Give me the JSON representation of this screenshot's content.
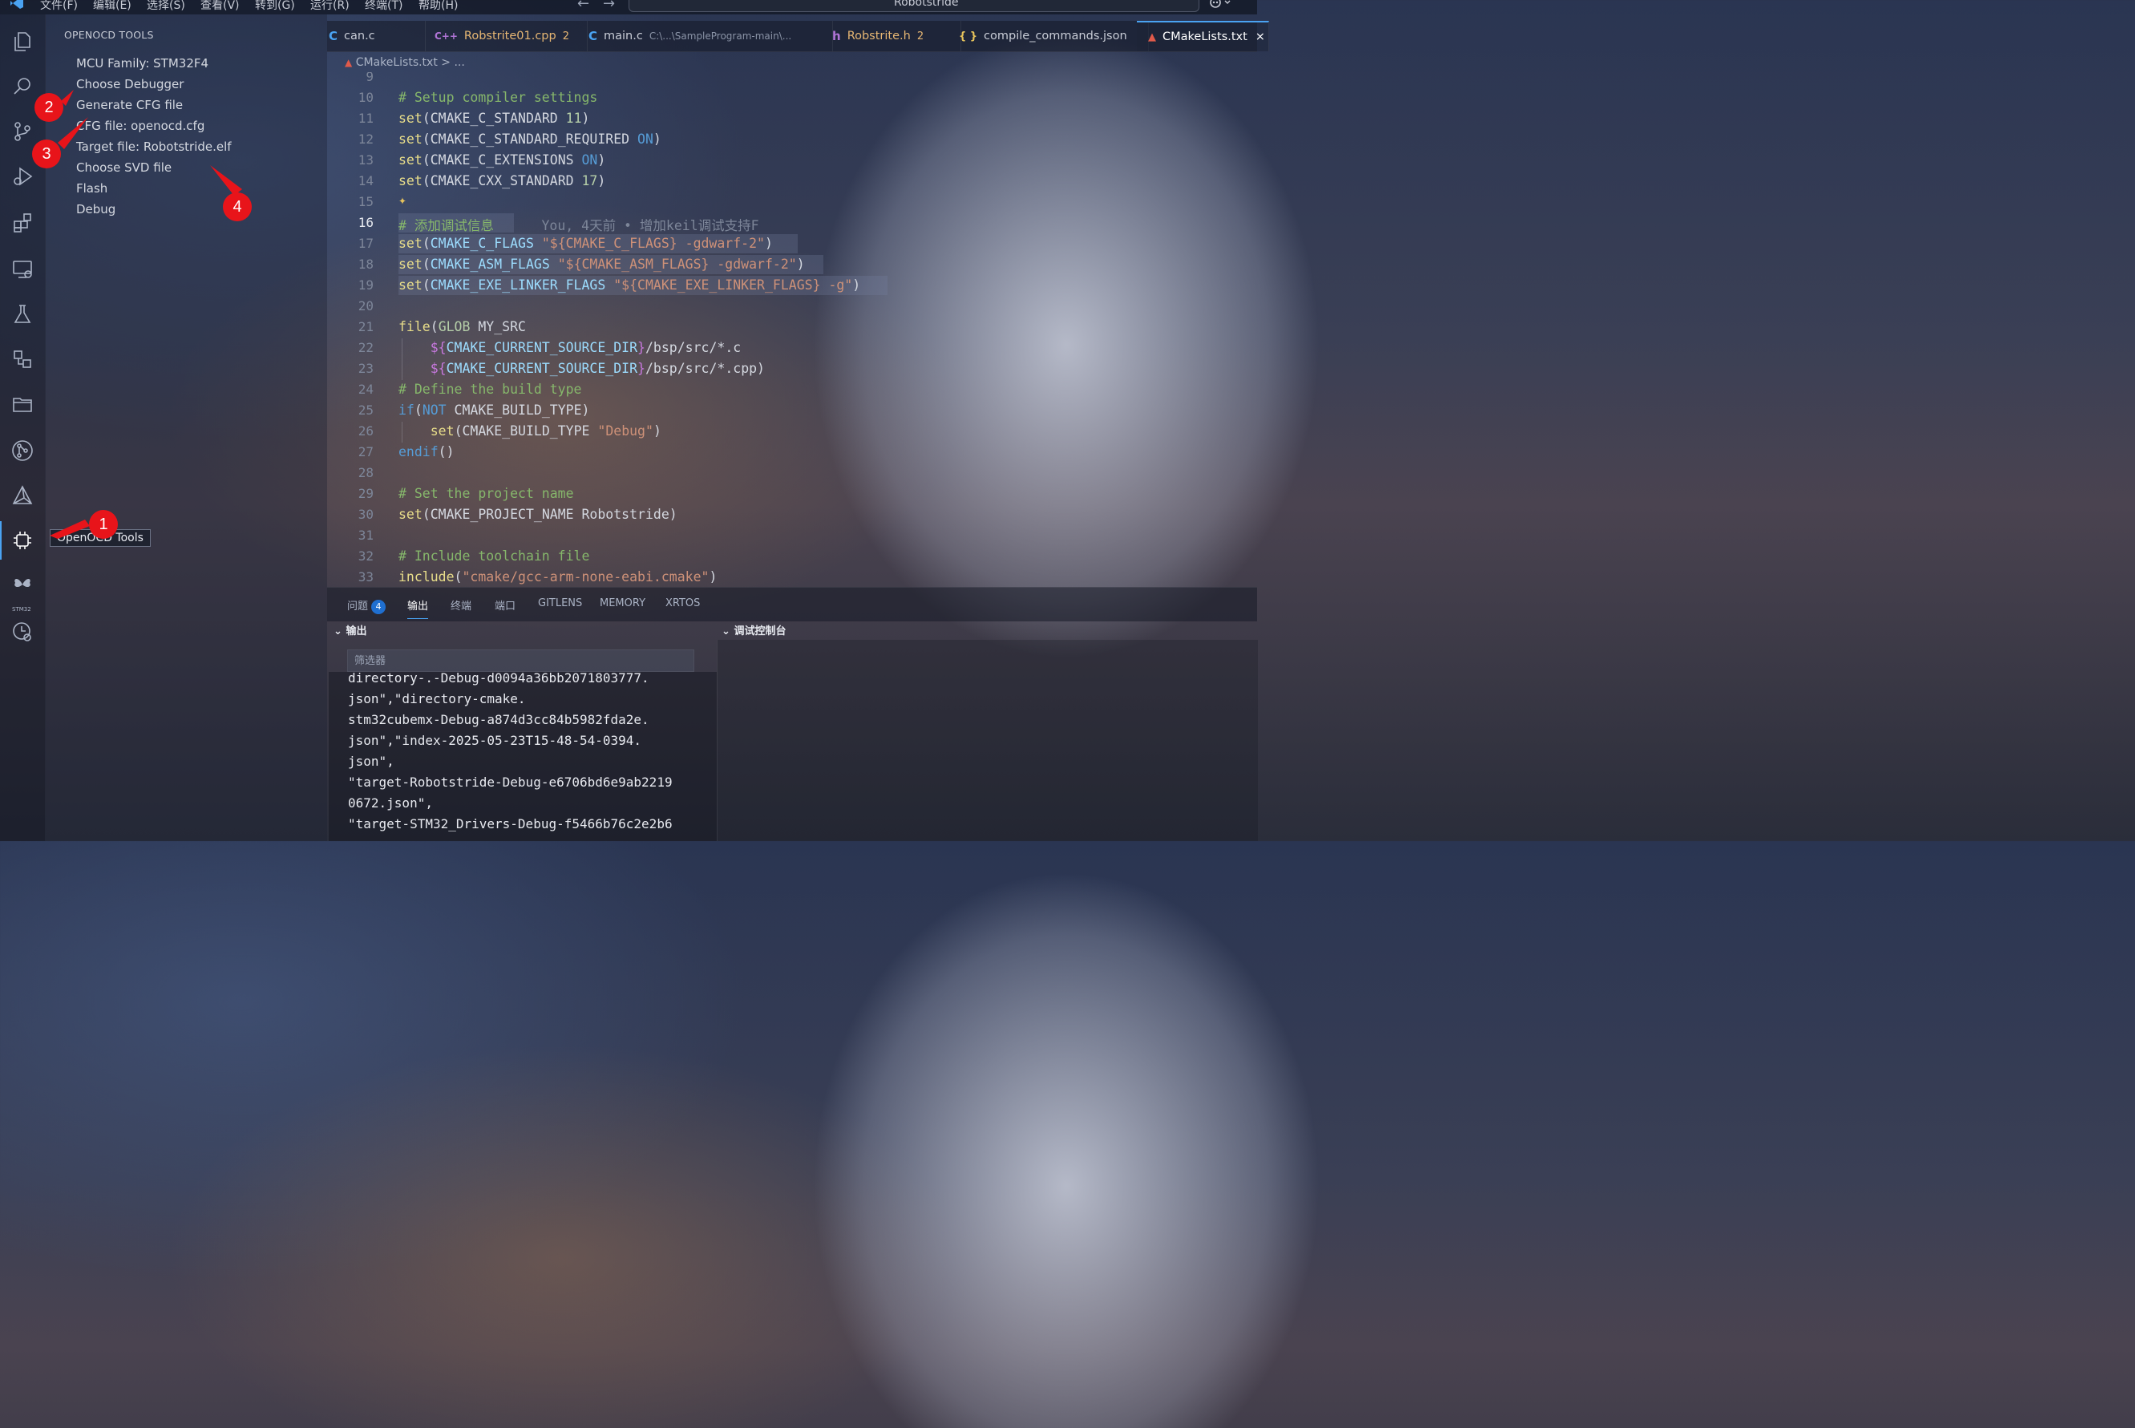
{
  "menubar": {
    "items": [
      "文件(F)",
      "编辑(E)",
      "选择(S)",
      "查看(V)",
      "转到(G)",
      "运行(R)",
      "终端(T)",
      "帮助(H)"
    ],
    "back_glyph": "←",
    "forward_glyph": "→",
    "search_text": "Robotstride"
  },
  "activity": {
    "stm_label": "STM32",
    "tooltip": "OpenOCD Tools"
  },
  "sidebar": {
    "title": "OPENOCD TOOLS",
    "items": [
      "MCU Family: STM32F4",
      "Choose Debugger",
      "Generate CFG file",
      "CFG file: openocd.cfg",
      "Target file: Robotstride.elf",
      "Choose SVD file",
      "Flash",
      "Debug"
    ]
  },
  "annotations": [
    "1",
    "2",
    "3",
    "4"
  ],
  "tabs": [
    {
      "label": "can.c",
      "icon": "C",
      "icon_color": "#4aa3f2"
    },
    {
      "label": "Robstrite01.cpp",
      "icon": "C++",
      "icon_color": "#b074d6",
      "count": "2"
    },
    {
      "label": "main.c",
      "icon": "C",
      "icon_color": "#4aa3f2",
      "path": "C:\\...\\SampleProgram-main\\..."
    },
    {
      "label": "Robstrite.h",
      "icon": "h",
      "icon_color": "#b074d6",
      "count": "2"
    },
    {
      "label": "compile_commands.json",
      "icon": "{ }",
      "icon_color": "#e6c35c"
    },
    {
      "label": "CMakeLists.txt",
      "icon": "▲",
      "icon_color": "#e05a4a",
      "close": "×"
    }
  ],
  "breadcrumb": {
    "file": "CMakeLists.txt",
    "sep": ">",
    "more": "..."
  },
  "editor": {
    "line_numbers": [
      "9",
      "10",
      "11",
      "12",
      "13",
      "14",
      "15",
      "16",
      "17",
      "18",
      "19",
      "20",
      "21",
      "22",
      "23",
      "24",
      "25",
      "26",
      "27",
      "28",
      "29",
      "30",
      "31",
      "32",
      "33"
    ],
    "l10": "# Setup compiler settings",
    "l11": {
      "fn": "set",
      "p1": "(",
      "var": "CMAKE_C_STANDARD",
      "num": " 11",
      "p2": ")"
    },
    "l12": {
      "fn": "set",
      "p1": "(",
      "var": "CMAKE_C_STANDARD_REQUIRED",
      "kw": " ON",
      "p2": ")"
    },
    "l13": {
      "fn": "set",
      "p1": "(",
      "var": "CMAKE_C_EXTENSIONS",
      "kw": " ON",
      "p2": ")"
    },
    "l14": {
      "fn": "set",
      "p1": "(",
      "var": "CMAKE_CXX_STANDARD",
      "num": " 17",
      "p2": ")"
    },
    "l15_icon": "✦",
    "l16": {
      "comment": "# 添加调试信息",
      "blame": "You, 4天前 • 增加keil调试支持F"
    },
    "l17": {
      "fn": "set",
      "p1": "(",
      "var": "CMAKE_C_FLAGS",
      "str": " \"${CMAKE_C_FLAGS} -gdwarf-2\"",
      "p2": ")"
    },
    "l18": {
      "fn": "set",
      "p1": "(",
      "var": "CMAKE_ASM_FLAGS",
      "str": " \"${CMAKE_ASM_FLAGS} -gdwarf-2\"",
      "p2": ")"
    },
    "l19": {
      "fn": "set",
      "p1": "(",
      "var": "CMAKE_EXE_LINKER_FLAGS",
      "str": " \"${CMAKE_EXE_LINKER_FLAGS} -g\"",
      "p2": ")"
    },
    "l21": {
      "fn": "file",
      "p1": "(",
      "kw": "GLOB",
      "var": " MY_SRC"
    },
    "l22": {
      "d1": "${",
      "var": "CMAKE_CURRENT_SOURCE_DIR",
      "d2": "}",
      "rest": "/bsp/src/*.c"
    },
    "l23": {
      "d1": "${",
      "var": "CMAKE_CURRENT_SOURCE_DIR",
      "d2": "}",
      "rest": "/bsp/src/*.cpp)"
    },
    "l24": "# Define the build type",
    "l25": {
      "kw": "if",
      "p1": "(",
      "kw2": "NOT",
      "var": " CMAKE_BUILD_TYPE",
      "p2": ")"
    },
    "l26": {
      "fn": "set",
      "p1": "(",
      "var": "CMAKE_BUILD_TYPE",
      "str": " \"Debug\"",
      "p2": ")"
    },
    "l27": {
      "kw": "endif",
      "p": "()"
    },
    "l29": "# Set the project name",
    "l30": {
      "fn": "set",
      "p1": "(",
      "var": "CMAKE_PROJECT_NAME",
      "rest": " Robotstride",
      "p2": ")"
    },
    "l32": "# Include toolchain file",
    "l33": {
      "fn": "include",
      "p1": "(",
      "str": "\"cmake/gcc-arm-none-eabi.cmake\"",
      "p2": ")"
    }
  },
  "panel": {
    "tabs": [
      "问题",
      "输出",
      "终端",
      "端口",
      "GITLENS",
      "MEMORY",
      "XRTOS"
    ],
    "problems_count": "4",
    "output_header": "输出",
    "debug_header": "调试控制台",
    "filter_placeholder": "筛选器",
    "output_lines": [
      "directory-.-Debug-d0094a36bb2071803777.",
      "json\",\"directory-cmake.",
      "stm32cubemx-Debug-a874d3cc84b5982fda2e.",
      "json\",\"index-2025-05-23T15-48-54-0394.",
      "json\",",
      "\"target-Robotstride-Debug-e6706bd6e9ab2219",
      "0672.json\",",
      "\"target-STM32_Drivers-Debug-f5466b76c2e2b6"
    ]
  },
  "colors": {
    "accent": "#4aa3f2",
    "annotation_red": "#e8141a",
    "warning": "#e6b673"
  }
}
